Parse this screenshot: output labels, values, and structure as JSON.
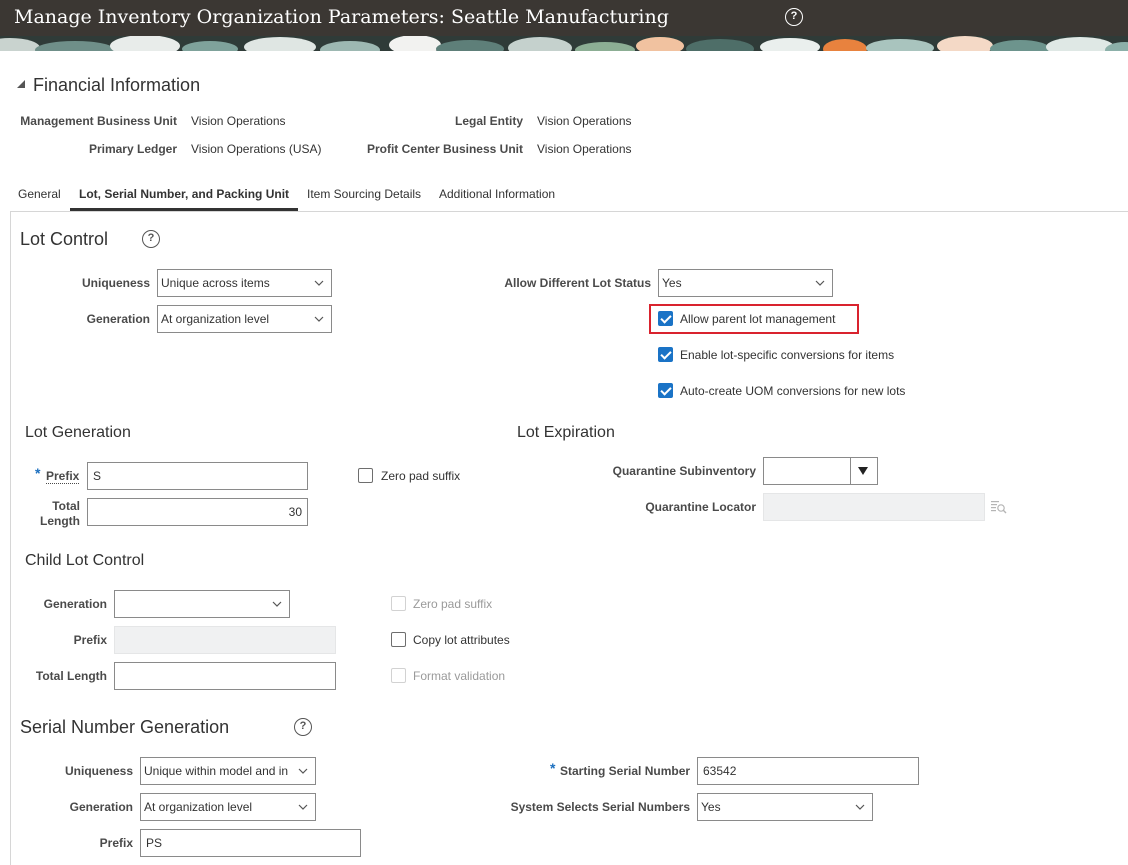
{
  "header": {
    "title": "Manage Inventory Organization Parameters: Seattle Manufacturing",
    "help_icon": "?"
  },
  "financial": {
    "title": "Financial Information",
    "collapse_icon": "triangle-down-icon",
    "mgmt_bu_label": "Management Business Unit",
    "mgmt_bu_value": "Vision Operations",
    "legal_entity_label": "Legal Entity",
    "legal_entity_value": "Vision Operations",
    "primary_ledger_label": "Primary Ledger",
    "primary_ledger_value": "Vision Operations (USA)",
    "profit_center_label": "Profit Center Business Unit",
    "profit_center_value": "Vision Operations"
  },
  "tabs": [
    {
      "label": "General"
    },
    {
      "label": "Lot, Serial Number, and Packing Unit"
    },
    {
      "label": "Item Sourcing Details"
    },
    {
      "label": "Additional Information"
    }
  ],
  "active_tab": 1,
  "lot_control": {
    "title": "Lot Control",
    "help_icon": "?",
    "uniqueness_label": "Uniqueness",
    "uniqueness_value": "Unique across items",
    "generation_label": "Generation",
    "generation_value": "At organization level",
    "allow_diff_status_label": "Allow Different Lot Status",
    "allow_diff_status_value": "Yes",
    "allow_parent_label": "Allow parent lot management",
    "allow_parent_checked": true,
    "enable_conv_label": "Enable lot-specific conversions for items",
    "enable_conv_checked": true,
    "auto_uom_label": "Auto-create UOM conversions for new lots",
    "auto_uom_checked": true
  },
  "lot_generation": {
    "title": "Lot Generation",
    "required_mark": "*",
    "prefix_label": "Prefix",
    "prefix_value": "S",
    "total_length_label_1": "Total",
    "total_length_label_2": "Length",
    "total_length_value": "30",
    "zero_pad_label": "Zero pad suffix",
    "zero_pad_checked": false
  },
  "lot_expiration": {
    "title": "Lot Expiration",
    "quarantine_sub_label": "Quarantine Subinventory",
    "quarantine_sub_value": "",
    "quarantine_loc_label": "Quarantine Locator",
    "quarantine_loc_value": "",
    "search_icon": "search-list-icon"
  },
  "child_lot": {
    "title": "Child Lot Control",
    "generation_label": "Generation",
    "generation_value": "",
    "prefix_label": "Prefix",
    "prefix_value": "",
    "total_length_label": "Total Length",
    "total_length_value": "",
    "zero_pad_label": "Zero pad suffix",
    "copy_attr_label": "Copy lot attributes",
    "format_val_label": "Format validation"
  },
  "serial": {
    "title": "Serial Number Generation",
    "help_icon": "?",
    "uniqueness_label": "Uniqueness",
    "uniqueness_value": "Unique within model and in",
    "generation_label": "Generation",
    "generation_value": "At organization level",
    "prefix_label": "Prefix",
    "prefix_value": "PS",
    "required_mark": "*",
    "starting_label": "Starting Serial Number",
    "starting_value": "63542",
    "system_selects_label": "System Selects Serial Numbers",
    "system_selects_value": "Yes"
  },
  "colors": {
    "header_bg": "#3b3733",
    "checkbox_blue": "#1a73c6",
    "highlight_red": "#d9232e",
    "required_blue": "#1b6fbf"
  }
}
